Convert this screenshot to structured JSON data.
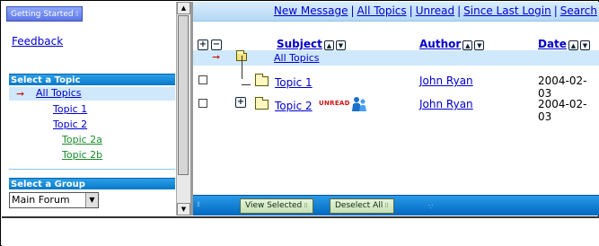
{
  "left_pane": {
    "getting_started_label": "Getting Started",
    "feedback_label": "Feedback",
    "select_topic_heading": "Select a Topic",
    "topics": [
      {
        "label": "All Topics",
        "current": true
      },
      {
        "label": "Topic 1"
      },
      {
        "label": "Topic 2"
      },
      {
        "label": "Topic 2a"
      },
      {
        "label": "Topic 2b"
      }
    ],
    "select_group_heading": "Select a Group",
    "group_selected": "Main Forum"
  },
  "top_links": [
    {
      "label": "New Message"
    },
    {
      "label": "All Topics"
    },
    {
      "label": "Unread"
    },
    {
      "label": "Since Last Login"
    },
    {
      "label": "Search"
    }
  ],
  "message_list": {
    "columns": {
      "subject": "Subject",
      "author": "Author",
      "date": "Date"
    },
    "root_label": "All Topics",
    "rows": [
      {
        "subject": "Topic 1",
        "author": "John Ryan",
        "date": "2004-02-03",
        "unread": false,
        "expandable": false
      },
      {
        "subject": "Topic 2",
        "author": "John Ryan",
        "date": "2004-02-03",
        "unread": true,
        "unread_label": "UNREAD",
        "expandable": true
      }
    ]
  },
  "bottom_bar": {
    "view_selected_label": "View Selected",
    "deselect_all_label": "Deselect All"
  },
  "colors": {
    "link": "#0000cc",
    "subtopic_link": "#1a8a2a",
    "header_blue": "#0a78c8",
    "highlight_row": "#cfe8fb",
    "unread_red": "#d01010"
  }
}
